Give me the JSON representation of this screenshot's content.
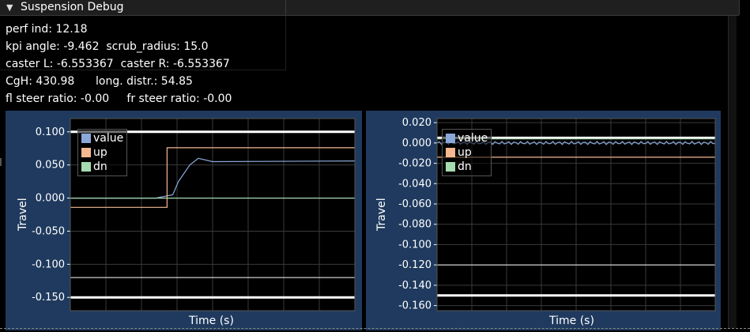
{
  "window": {
    "title": "Suspension Debug",
    "collapse_glyph": "▼"
  },
  "info": {
    "lines": [
      "perf ind: 12.18",
      "kpi angle: -9.462  scrub_radius: 15.0",
      "caster L: -6.553367  caster R: -6.553367",
      "CgH: 430.98      long. distr.: 54.85",
      "fl steer ratio: -0.00     fr steer ratio: -0.00"
    ]
  },
  "colors": {
    "plot_bg": "#000000",
    "frame_bg": "#1f3a5e",
    "value": "#8aa8d8",
    "up": "#f5b890",
    "dn": "#a6dcb0",
    "grid": "#3a3a3a"
  },
  "legend": [
    "value",
    "up",
    "dn"
  ],
  "chart_data": [
    {
      "type": "line",
      "xlabel": "Time (s)",
      "ylabel": "Travel",
      "ylim": [
        -0.17,
        0.12
      ],
      "yticks": [
        0.1,
        0.05,
        0.0,
        -0.05,
        -0.1,
        -0.15
      ],
      "ytick_labels": [
        "0.100",
        "0.050",
        "0.000",
        "-0.050",
        "-0.100",
        "-0.150"
      ],
      "hlines": [
        0.1,
        -0.12,
        -0.15
      ],
      "grid": true,
      "legend_position": "top-left",
      "series": [
        {
          "name": "value",
          "x": [
            0,
            0.3,
            0.36,
            0.38,
            0.42,
            0.45,
            0.5,
            1.0
          ],
          "y": [
            0,
            0,
            0.005,
            0.025,
            0.05,
            0.06,
            0.055,
            0.056
          ]
        },
        {
          "name": "up",
          "x": [
            0,
            0.34,
            0.34,
            1.0
          ],
          "y": [
            -0.014,
            -0.014,
            0.076,
            0.076
          ]
        },
        {
          "name": "dn",
          "x": [
            0,
            1.0
          ],
          "y": [
            0,
            0
          ]
        }
      ]
    },
    {
      "type": "line",
      "xlabel": "Time (s)",
      "ylabel": "Travel",
      "ylim": [
        -0.165,
        0.024
      ],
      "yticks": [
        0.02,
        0.0,
        -0.02,
        -0.04,
        -0.06,
        -0.08,
        -0.1,
        -0.12,
        -0.14,
        -0.16
      ],
      "ytick_labels": [
        "0.020",
        "0.000",
        "-0.020",
        "-0.040",
        "-0.060",
        "-0.080",
        "-0.100",
        "-0.120",
        "-0.140",
        "-0.160"
      ],
      "hlines": [
        0.005,
        -0.12,
        -0.15
      ],
      "grid": true,
      "legend_position": "top-left",
      "series": [
        {
          "name": "value",
          "x": [
            0,
            1.0
          ],
          "y": [
            0.0,
            0.0
          ]
        },
        {
          "name": "up",
          "x": [
            0,
            1.0
          ],
          "y": [
            -0.014,
            -0.014
          ]
        },
        {
          "name": "dn",
          "x": [
            0,
            1.0
          ],
          "y": [
            0.004,
            0.004
          ]
        }
      ]
    }
  ]
}
